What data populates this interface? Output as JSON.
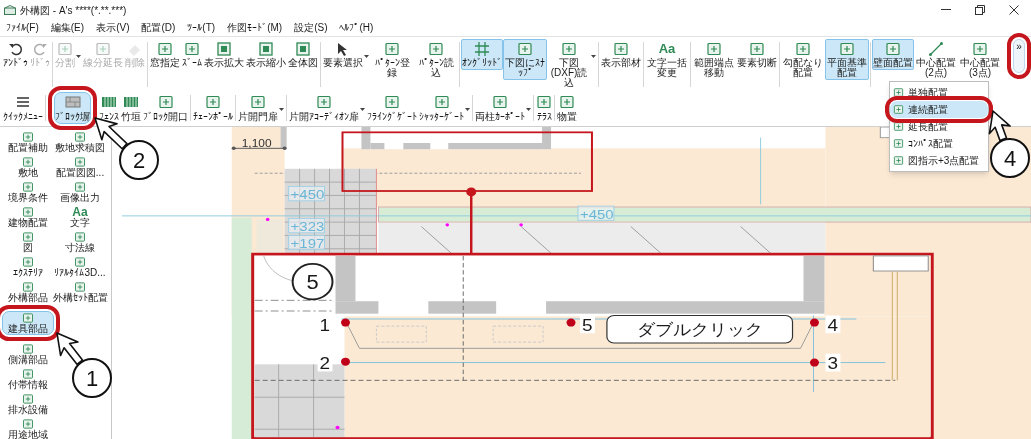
{
  "window": {
    "title": "外構図 - A's ****(*.**.***)"
  },
  "menu": [
    "ﾌｧｲﾙ(F)",
    "編集(E)",
    "表示(V)",
    "配置(D)",
    "ﾂｰﾙ(T)",
    "作図ﾓｰﾄﾞ(M)",
    "設定(S)",
    "ﾍﾙﾌﾟ(H)"
  ],
  "toolbar_main": {
    "groups": [
      [
        {
          "label": "ｱﾝﾄﾞｩ",
          "disabled": false,
          "selected": false,
          "dropdown": false
        },
        {
          "label": "ﾘﾄﾞｩ",
          "disabled": true,
          "selected": false,
          "dropdown": false
        }
      ],
      [
        {
          "label": "分割",
          "disabled": true,
          "selected": false,
          "dropdown": true
        },
        {
          "label": "線分延長",
          "disabled": true,
          "selected": false,
          "dropdown": false
        },
        {
          "label": "削除",
          "disabled": true,
          "selected": false,
          "dropdown": false
        }
      ],
      [
        {
          "label": "窓指定",
          "disabled": false,
          "selected": false,
          "dropdown": false
        },
        {
          "label": "ｽﾞｰﾑ",
          "disabled": false,
          "selected": false,
          "dropdown": false
        },
        {
          "label": "表示拡大",
          "disabled": false,
          "selected": false,
          "dropdown": false
        },
        {
          "label": "表示縮小",
          "disabled": false,
          "selected": false,
          "dropdown": false
        },
        {
          "label": "全体図",
          "disabled": false,
          "selected": false,
          "dropdown": false
        }
      ],
      [
        {
          "label": "要素選択",
          "disabled": false,
          "selected": false,
          "dropdown": true
        },
        {
          "label": "ﾊﾟﾀｰﾝ登録",
          "disabled": false,
          "selected": false,
          "dropdown": false
        },
        {
          "label": "ﾊﾟﾀｰﾝ読込",
          "disabled": false,
          "selected": false,
          "dropdown": false
        }
      ],
      [
        {
          "label": "ｵﾝｸﾞﾘｯﾄﾞ",
          "disabled": false,
          "selected": true,
          "dropdown": false
        },
        {
          "label": "下図にｽﾅｯﾌﾟ",
          "disabled": false,
          "selected": true,
          "dropdown": false
        },
        {
          "label": "下図(DXF)読込",
          "disabled": false,
          "selected": false,
          "dropdown": true
        }
      ],
      [
        {
          "label": "表示部材",
          "disabled": false,
          "selected": false,
          "dropdown": false
        }
      ],
      [
        {
          "label": "文字一括変更",
          "glyph": "Aa",
          "disabled": false,
          "selected": false,
          "dropdown": false
        }
      ],
      [
        {
          "label": "範囲端点移動",
          "disabled": false,
          "selected": false,
          "dropdown": false
        },
        {
          "label": "要素切断",
          "disabled": false,
          "selected": false,
          "dropdown": false
        }
      ],
      [
        {
          "label": "勾配なり配置",
          "disabled": false,
          "selected": false,
          "dropdown": false
        },
        {
          "label": "平面基準配置",
          "disabled": false,
          "selected": true,
          "dropdown": false
        }
      ],
      [
        {
          "label": "壁面配置",
          "disabled": false,
          "selected": true,
          "dropdown": false
        },
        {
          "label": "中心配置(2点)",
          "disabled": false,
          "selected": false,
          "dropdown": false
        },
        {
          "label": "中心配置(3点)",
          "disabled": false,
          "selected": false,
          "dropdown": false
        }
      ]
    ],
    "overflow": {
      "label": "»",
      "highlighted": true
    }
  },
  "toolbar_parts": {
    "groups": [
      [
        {
          "label": "ｸｲｯｸﾒﾆｭｰ",
          "selected": false,
          "dropdown": false,
          "highlighted": false
        }
      ],
      [
        {
          "label": "ﾌﾞﾛｯｸ塀",
          "selected": true,
          "dropdown": false,
          "highlighted": true
        },
        {
          "label": "ﾌｪﾝｽ",
          "selected": false,
          "dropdown": false,
          "highlighted": false
        },
        {
          "label": "竹垣",
          "selected": false,
          "dropdown": false,
          "highlighted": false
        },
        {
          "label": "ﾌﾞﾛｯｸ開口",
          "selected": false,
          "dropdown": false,
          "highlighted": false
        }
      ],
      [
        {
          "label": "ﾁｪｰﾝﾎﾟｰﾙ",
          "selected": false,
          "dropdown": false,
          "highlighted": false
        }
      ],
      [
        {
          "label": "片開門扉",
          "selected": false,
          "dropdown": true,
          "highlighted": false
        }
      ],
      [
        {
          "label": "片開ｱｺｰﾃﾞｨｵﾝ扉",
          "selected": false,
          "dropdown": true,
          "highlighted": false
        },
        {
          "label": "ﾌﾗｲﾝｸﾞｹﾞｰﾄ",
          "selected": false,
          "dropdown": false,
          "highlighted": false
        },
        {
          "label": "ｼｬｯﾀｰｹﾞｰﾄ",
          "selected": false,
          "dropdown": true,
          "highlighted": false
        }
      ],
      [
        {
          "label": "両柱ｶｰﾎﾟｰﾄ",
          "selected": false,
          "dropdown": true,
          "highlighted": false
        }
      ],
      [
        {
          "label": "ﾃﾗｽ",
          "selected": false,
          "dropdown": false,
          "highlighted": false
        }
      ],
      [
        {
          "label": "物置",
          "selected": false,
          "dropdown": false,
          "highlighted": false
        }
      ]
    ]
  },
  "sidebar": {
    "rows": [
      [
        {
          "label": "配置補助",
          "selected": false,
          "highlighted": false
        },
        {
          "label": "敷地求積図",
          "selected": false,
          "highlighted": false
        }
      ],
      [
        {
          "label": "敷地",
          "selected": false,
          "highlighted": false
        },
        {
          "label": "配置図図...",
          "selected": false,
          "highlighted": false
        }
      ],
      [
        {
          "label": "境界条件",
          "selected": false,
          "highlighted": false
        },
        {
          "label": "画像出力",
          "selected": false,
          "highlighted": false
        }
      ],
      [
        {
          "label": "建物配置",
          "selected": false,
          "highlighted": false
        },
        {
          "label": "文字",
          "glyph": "Aa",
          "selected": false,
          "highlighted": false
        }
      ],
      [
        {
          "label": "図",
          "selected": false,
          "highlighted": false
        },
        {
          "label": "寸法線",
          "selected": false,
          "highlighted": false
        }
      ],
      [
        {
          "label": "ｴｸｽﾃﾘｱ",
          "selected": false,
          "highlighted": false
        },
        {
          "label": "ﾘｱﾙﾀｲﾑ3D...",
          "selected": false,
          "highlighted": false
        }
      ],
      [
        {
          "label": "外構部品",
          "selected": false,
          "highlighted": false
        },
        {
          "label": "外構ｾｯﾄ配置",
          "selected": false,
          "highlighted": false
        }
      ],
      [
        {
          "label": "建具部品",
          "selected": true,
          "highlighted": true
        }
      ],
      [
        {
          "label": "側溝部品",
          "selected": false,
          "highlighted": false
        }
      ],
      [
        {
          "label": "付帯情報",
          "selected": false,
          "highlighted": false
        }
      ],
      [
        {
          "label": "排水設備",
          "selected": false,
          "highlighted": false
        }
      ],
      [
        {
          "label": "用途地域",
          "selected": false,
          "highlighted": false
        }
      ]
    ]
  },
  "dropdown_menu": {
    "items": [
      {
        "label": "単独配置",
        "selected": false,
        "highlighted": false
      },
      {
        "label": "連続配置",
        "selected": true,
        "highlighted": true
      },
      {
        "label": "延長配置",
        "selected": false,
        "highlighted": false
      },
      {
        "label": "ｺﾝﾊﾟｽ配置",
        "selected": false,
        "highlighted": false
      },
      {
        "label": "図指示+3点配置",
        "selected": false,
        "highlighted": false
      }
    ]
  },
  "drawing": {
    "dimension": "1,100",
    "levels": [
      "+450",
      "+323",
      "+197",
      "+450"
    ]
  },
  "detail": {
    "points": [
      "1",
      "5",
      "4",
      "2",
      "3"
    ],
    "hint": "ダブルクリック"
  },
  "callouts": [
    "1",
    "2",
    "4",
    "5"
  ]
}
